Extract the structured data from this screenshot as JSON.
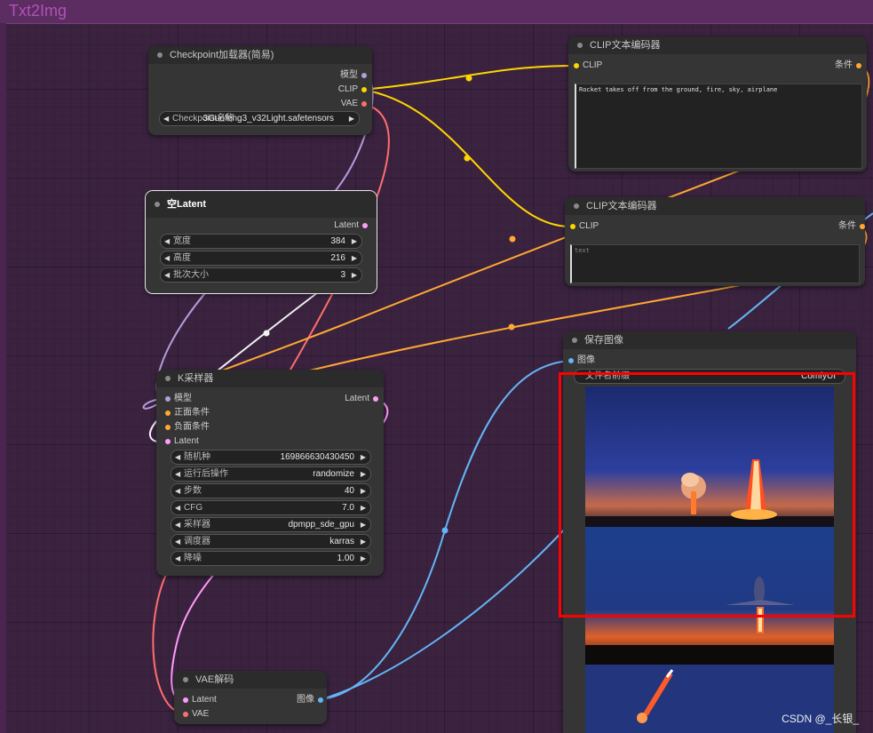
{
  "group": {
    "title": "Txt2Img"
  },
  "checkpoint": {
    "title": "Checkpoint加载器(简易)",
    "outputs": [
      "模型",
      "CLIP",
      "VAE"
    ],
    "widget": {
      "label": "Checkpoint名称",
      "value": "3Guofeng3_v32Light.safetensors"
    }
  },
  "clip_pos": {
    "title": "CLIP文本编码器",
    "input": "CLIP",
    "output": "条件",
    "text": "Rocket takes off from the ground, fire, sky, airplane"
  },
  "clip_neg": {
    "title": "CLIP文本编码器",
    "input": "CLIP",
    "output": "条件",
    "placeholder": "text"
  },
  "latent": {
    "title": "空Latent",
    "output": "Latent",
    "widgets": [
      {
        "label": "宽度",
        "value": "384"
      },
      {
        "label": "高度",
        "value": "216"
      },
      {
        "label": "批次大小",
        "value": "3"
      }
    ]
  },
  "ksampler": {
    "title": "K采样器",
    "inputs": [
      "模型",
      "正面条件",
      "负面条件",
      "Latent"
    ],
    "output": "Latent",
    "widgets": [
      {
        "label": "随机种",
        "value": "169866630430450"
      },
      {
        "label": "运行后操作",
        "value": "randomize"
      },
      {
        "label": "步数",
        "value": "40"
      },
      {
        "label": "CFG",
        "value": "7.0"
      },
      {
        "label": "采样器",
        "value": "dpmpp_sde_gpu"
      },
      {
        "label": "调度器",
        "value": "karras"
      },
      {
        "label": "降噪",
        "value": "1.00"
      }
    ]
  },
  "save": {
    "title": "保存图像",
    "input": "图像",
    "widget": {
      "label": "文件名前缀",
      "value": "ComfyUI"
    }
  },
  "vae_decode": {
    "title": "VAE解码",
    "inputs": [
      "Latent",
      "VAE"
    ],
    "output": "图像"
  },
  "colors": {
    "model": "#b39ddb",
    "clip": "#ffd500",
    "vae": "#ff6e6e",
    "latent": "#ff9cf9",
    "cond": "#ffa931",
    "image": "#64b5f6",
    "highlight": "#ff0000"
  },
  "watermark": "CSDN @_长银_"
}
